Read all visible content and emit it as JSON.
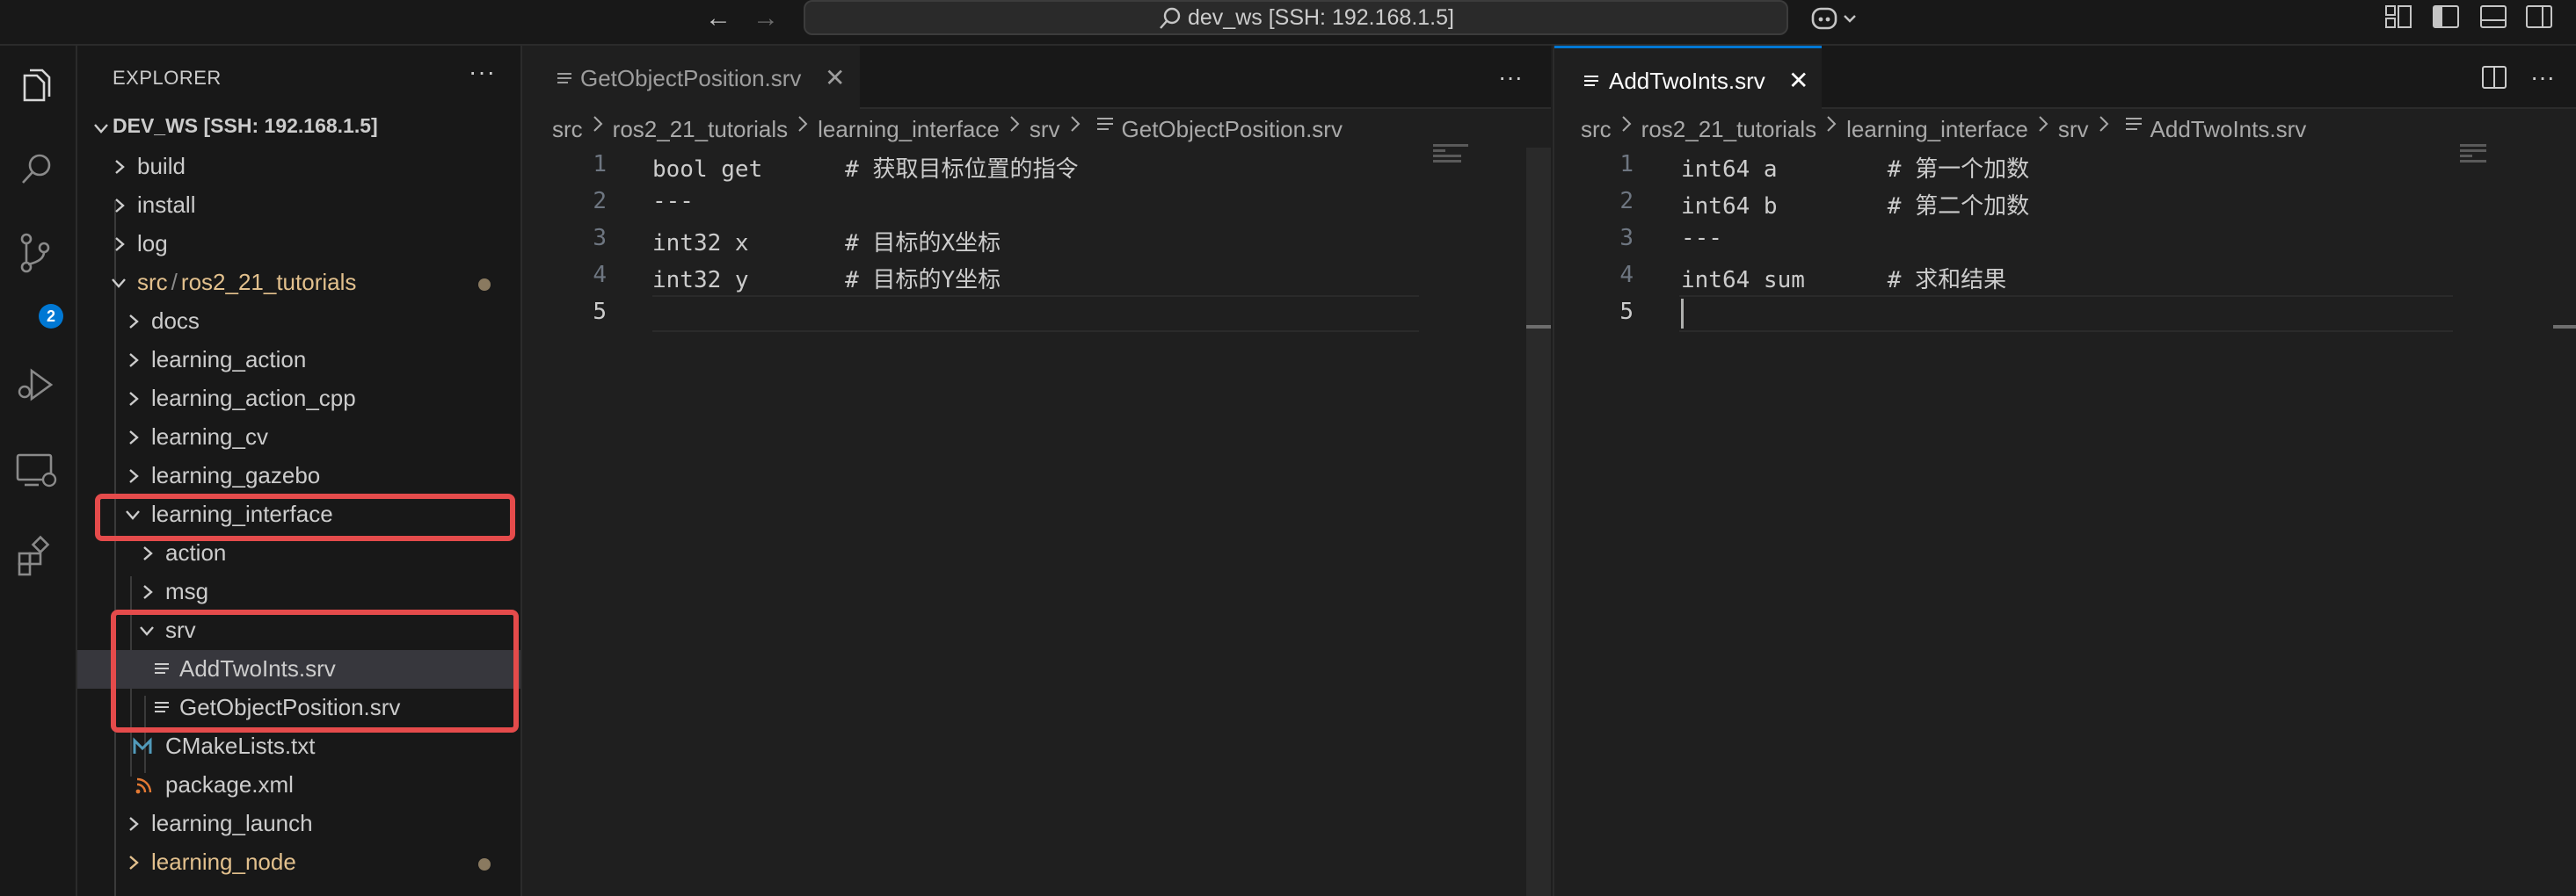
{
  "titlebar": {
    "command_center": "dev_ws [SSH: 192.168.1.5]"
  },
  "activity_bar": {
    "scm_badge": "2"
  },
  "explorer": {
    "title": "EXPLORER",
    "more": "···",
    "root": "DEV_WS [SSH: 192.168.1.5]",
    "items": {
      "build": "build",
      "install": "install",
      "log": "log",
      "src_prefix": "src",
      "src_sep": "/",
      "src_pkg": "ros2_21_tutorials",
      "docs": "docs",
      "learning_action": "learning_action",
      "learning_action_cpp": "learning_action_cpp",
      "learning_cv": "learning_cv",
      "learning_gazebo": "learning_gazebo",
      "learning_interface": "learning_interface",
      "action": "action",
      "msg": "msg",
      "srv": "srv",
      "addtwoints": "AddTwoInts.srv",
      "getobjectposition": "GetObjectPosition.srv",
      "cmakelists": "CMakeLists.txt",
      "package_xml": "package.xml",
      "learning_launch": "learning_launch",
      "learning_node": "learning_node"
    }
  },
  "editor_left": {
    "tab_label": "GetObjectPosition.srv",
    "tab_close": "✕",
    "more": "···",
    "breadcrumb": [
      "src",
      "ros2_21_tutorials",
      "learning_interface",
      "srv",
      "GetObjectPosition.srv"
    ],
    "lines": [
      {
        "n": "1",
        "text": "bool get      # 获取目标位置的指令"
      },
      {
        "n": "2",
        "text": "---"
      },
      {
        "n": "3",
        "text": "int32 x       # 目标的X坐标"
      },
      {
        "n": "4",
        "text": "int32 y       # 目标的Y坐标"
      },
      {
        "n": "5",
        "text": ""
      }
    ]
  },
  "editor_right": {
    "tab_label": "AddTwoInts.srv",
    "tab_close": "✕",
    "more": "···",
    "breadcrumb": [
      "src",
      "ros2_21_tutorials",
      "learning_interface",
      "srv",
      "AddTwoInts.srv"
    ],
    "lines": [
      {
        "n": "1",
        "text": "int64 a        # 第一个加数"
      },
      {
        "n": "2",
        "text": "int64 b        # 第二个加数"
      },
      {
        "n": "3",
        "text": "---"
      },
      {
        "n": "4",
        "text": "int64 sum      # 求和结果"
      },
      {
        "n": "5",
        "text": ""
      }
    ]
  },
  "colors": {
    "accent": "#0078d4",
    "highlight_box": "#e54b4b",
    "modified_folder": "#e2c08d",
    "background": "#1f1f1f"
  }
}
